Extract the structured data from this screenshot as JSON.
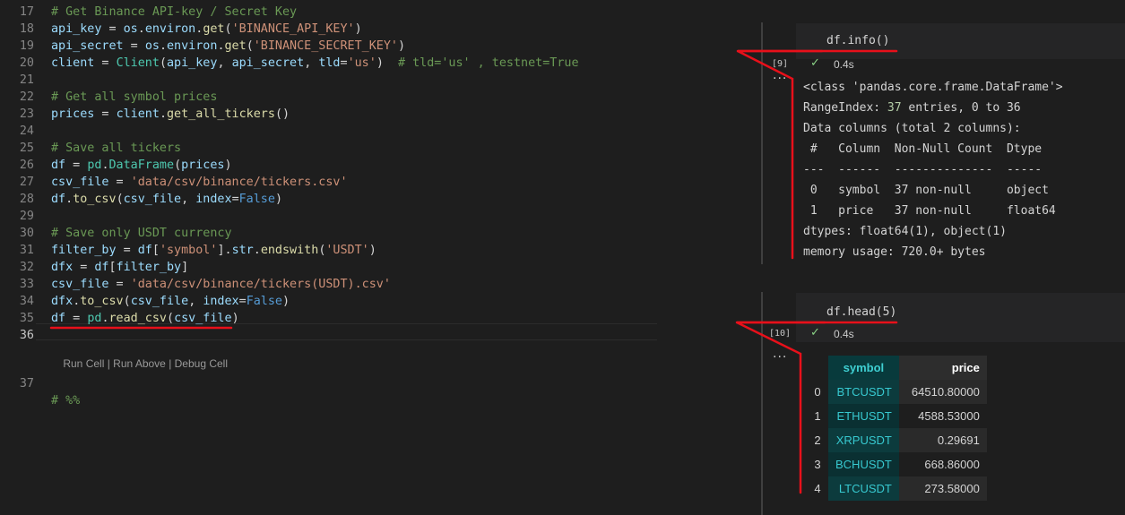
{
  "editor": {
    "lines": [
      {
        "n": "17",
        "tokens": [
          {
            "c": "c-com",
            "t": "# Get Binance API-key / Secret Key"
          }
        ]
      },
      {
        "n": "18",
        "tokens": [
          {
            "c": "c-var",
            "t": "api_key"
          },
          {
            "c": "c-op",
            "t": " = "
          },
          {
            "c": "c-var",
            "t": "os"
          },
          {
            "c": "c-op",
            "t": "."
          },
          {
            "c": "c-var",
            "t": "environ"
          },
          {
            "c": "c-op",
            "t": "."
          },
          {
            "c": "c-fn",
            "t": "get"
          },
          {
            "c": "c-op",
            "t": "("
          },
          {
            "c": "c-str",
            "t": "'BINANCE_API_KEY'"
          },
          {
            "c": "c-op",
            "t": ")"
          }
        ]
      },
      {
        "n": "19",
        "tokens": [
          {
            "c": "c-var",
            "t": "api_secret"
          },
          {
            "c": "c-op",
            "t": " = "
          },
          {
            "c": "c-var",
            "t": "os"
          },
          {
            "c": "c-op",
            "t": "."
          },
          {
            "c": "c-var",
            "t": "environ"
          },
          {
            "c": "c-op",
            "t": "."
          },
          {
            "c": "c-fn",
            "t": "get"
          },
          {
            "c": "c-op",
            "t": "("
          },
          {
            "c": "c-str",
            "t": "'BINANCE_SECRET_KEY'"
          },
          {
            "c": "c-op",
            "t": ")"
          }
        ]
      },
      {
        "n": "20",
        "tokens": [
          {
            "c": "c-var",
            "t": "client"
          },
          {
            "c": "c-op",
            "t": " = "
          },
          {
            "c": "c-cls",
            "t": "Client"
          },
          {
            "c": "c-op",
            "t": "("
          },
          {
            "c": "c-var",
            "t": "api_key"
          },
          {
            "c": "c-op",
            "t": ", "
          },
          {
            "c": "c-var",
            "t": "api_secret"
          },
          {
            "c": "c-op",
            "t": ", "
          },
          {
            "c": "c-var",
            "t": "tld"
          },
          {
            "c": "c-op",
            "t": "="
          },
          {
            "c": "c-str",
            "t": "'us'"
          },
          {
            "c": "c-op",
            "t": ")  "
          },
          {
            "c": "c-com",
            "t": "# tld='us' , testnet=True"
          }
        ]
      },
      {
        "n": "21",
        "tokens": []
      },
      {
        "n": "22",
        "tokens": [
          {
            "c": "c-com",
            "t": "# Get all symbol prices"
          }
        ]
      },
      {
        "n": "23",
        "tokens": [
          {
            "c": "c-var",
            "t": "prices"
          },
          {
            "c": "c-op",
            "t": " = "
          },
          {
            "c": "c-var",
            "t": "client"
          },
          {
            "c": "c-op",
            "t": "."
          },
          {
            "c": "c-fn",
            "t": "get_all_tickers"
          },
          {
            "c": "c-op",
            "t": "()"
          }
        ]
      },
      {
        "n": "24",
        "tokens": []
      },
      {
        "n": "25",
        "tokens": [
          {
            "c": "c-com",
            "t": "# Save all tickers"
          }
        ]
      },
      {
        "n": "26",
        "tokens": [
          {
            "c": "c-var",
            "t": "df"
          },
          {
            "c": "c-op",
            "t": " = "
          },
          {
            "c": "c-cls",
            "t": "pd"
          },
          {
            "c": "c-op",
            "t": "."
          },
          {
            "c": "c-cls",
            "t": "DataFrame"
          },
          {
            "c": "c-op",
            "t": "("
          },
          {
            "c": "c-var",
            "t": "prices"
          },
          {
            "c": "c-op",
            "t": ")"
          }
        ]
      },
      {
        "n": "27",
        "tokens": [
          {
            "c": "c-var",
            "t": "csv_file"
          },
          {
            "c": "c-op",
            "t": " = "
          },
          {
            "c": "c-str",
            "t": "'data/csv/binance/tickers.csv'"
          }
        ]
      },
      {
        "n": "28",
        "tokens": [
          {
            "c": "c-var",
            "t": "df"
          },
          {
            "c": "c-op",
            "t": "."
          },
          {
            "c": "c-fn",
            "t": "to_csv"
          },
          {
            "c": "c-op",
            "t": "("
          },
          {
            "c": "c-var",
            "t": "csv_file"
          },
          {
            "c": "c-op",
            "t": ", "
          },
          {
            "c": "c-var",
            "t": "index"
          },
          {
            "c": "c-op",
            "t": "="
          },
          {
            "c": "c-kw",
            "t": "False"
          },
          {
            "c": "c-op",
            "t": ")"
          }
        ]
      },
      {
        "n": "29",
        "tokens": []
      },
      {
        "n": "30",
        "tokens": [
          {
            "c": "c-com",
            "t": "# Save only USDT currency"
          }
        ]
      },
      {
        "n": "31",
        "tokens": [
          {
            "c": "c-var",
            "t": "filter_by"
          },
          {
            "c": "c-op",
            "t": " = "
          },
          {
            "c": "c-var",
            "t": "df"
          },
          {
            "c": "c-op",
            "t": "["
          },
          {
            "c": "c-str",
            "t": "'symbol'"
          },
          {
            "c": "c-op",
            "t": "]."
          },
          {
            "c": "c-var",
            "t": "str"
          },
          {
            "c": "c-op",
            "t": "."
          },
          {
            "c": "c-fn",
            "t": "endswith"
          },
          {
            "c": "c-op",
            "t": "("
          },
          {
            "c": "c-str",
            "t": "'USDT'"
          },
          {
            "c": "c-op",
            "t": ")"
          }
        ]
      },
      {
        "n": "32",
        "tokens": [
          {
            "c": "c-var",
            "t": "dfx"
          },
          {
            "c": "c-op",
            "t": " = "
          },
          {
            "c": "c-var",
            "t": "df"
          },
          {
            "c": "c-op",
            "t": "["
          },
          {
            "c": "c-var",
            "t": "filter_by"
          },
          {
            "c": "c-op",
            "t": "]"
          }
        ]
      },
      {
        "n": "33",
        "tokens": [
          {
            "c": "c-var",
            "t": "csv_file"
          },
          {
            "c": "c-op",
            "t": " = "
          },
          {
            "c": "c-str",
            "t": "'data/csv/binance/tickers(USDT).csv'"
          }
        ]
      },
      {
        "n": "34",
        "tokens": [
          {
            "c": "c-var",
            "t": "dfx"
          },
          {
            "c": "c-op",
            "t": "."
          },
          {
            "c": "c-fn",
            "t": "to_csv"
          },
          {
            "c": "c-op",
            "t": "("
          },
          {
            "c": "c-var",
            "t": "csv_file"
          },
          {
            "c": "c-op",
            "t": ", "
          },
          {
            "c": "c-var",
            "t": "index"
          },
          {
            "c": "c-op",
            "t": "="
          },
          {
            "c": "c-kw",
            "t": "False"
          },
          {
            "c": "c-op",
            "t": ")"
          }
        ]
      },
      {
        "n": "35",
        "tokens": [
          {
            "c": "c-var",
            "t": "df"
          },
          {
            "c": "c-op",
            "t": " = "
          },
          {
            "c": "c-cls",
            "t": "pd"
          },
          {
            "c": "c-op",
            "t": "."
          },
          {
            "c": "c-fn",
            "t": "read_csv"
          },
          {
            "c": "c-op",
            "t": "("
          },
          {
            "c": "c-var",
            "t": "csv_file"
          },
          {
            "c": "c-op",
            "t": ")"
          }
        ]
      },
      {
        "n": "36",
        "tokens": [],
        "active": true
      }
    ],
    "codelens": "Run Cell | Run Above | Debug Cell",
    "line37": {
      "n": "37",
      "text": "# %%"
    }
  },
  "cells": [
    {
      "code": "df.info()",
      "exec_count": "[9]",
      "status_time": "0.4s",
      "more": "···",
      "output_lines": [
        "<class 'pandas.core.frame.DataFrame'>",
        "RangeIndex: 37 entries, 0 to 36",
        "Data columns (total 2 columns):",
        " #   Column  Non-Null Count  Dtype  ",
        "---  ------  --------------  -----  ",
        " 0   symbol  37 non-null     object ",
        " 1   price   37 non-null     float64",
        "dtypes: float64(1), object(1)",
        "memory usage: 720.0+ bytes"
      ]
    },
    {
      "code": "df.head(5)",
      "exec_count": "[10]",
      "status_time": "0.4s",
      "more": "···",
      "table": {
        "headers": [
          "",
          "symbol",
          "price"
        ],
        "rows": [
          [
            "0",
            "BTCUSDT",
            "64510.80000"
          ],
          [
            "1",
            "ETHUSDT",
            "4588.53000"
          ],
          [
            "2",
            "XRPUSDT",
            "0.29691"
          ],
          [
            "3",
            "BCHUSDT",
            "668.86000"
          ],
          [
            "4",
            "LTCUSDT",
            "273.58000"
          ]
        ]
      }
    }
  ],
  "colors": {
    "annotation": "#e8101a",
    "success": "#89d185",
    "symbol": "#37c9d0"
  }
}
